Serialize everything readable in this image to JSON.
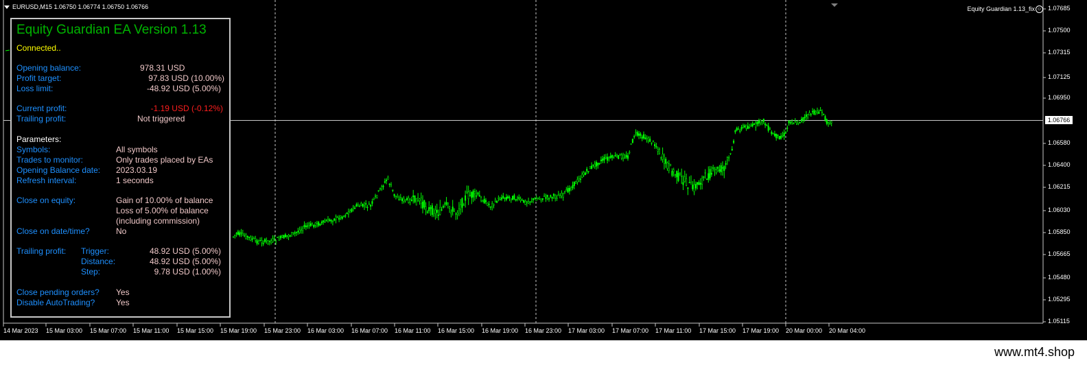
{
  "chart": {
    "header": "EURUSD,M15  1.06750 1.06774 1.06750 1.06766",
    "ea_label": "Equity Guardian 1.13_fix",
    "ea_smiley": "☺",
    "current_price": "1.06766",
    "price_ticks": [
      "1.07685",
      "1.07500",
      "1.07315",
      "1.07125",
      "1.06950",
      "1.06766",
      "1.06580",
      "1.06400",
      "1.06215",
      "1.06030",
      "1.05850",
      "1.05665",
      "1.05480",
      "1.05295",
      "1.05115"
    ],
    "time_ticks": [
      "14 Mar 2023",
      "15 Mar 03:00",
      "15 Mar 07:00",
      "15 Mar 11:00",
      "15 Mar 15:00",
      "15 Mar 19:00",
      "15 Mar 23:00",
      "16 Mar 03:00",
      "16 Mar 07:00",
      "16 Mar 11:00",
      "16 Mar 15:00",
      "16 Mar 19:00",
      "16 Mar 23:00",
      "17 Mar 03:00",
      "17 Mar 07:00",
      "17 Mar 11:00",
      "17 Mar 15:00",
      "17 Mar 19:00",
      "20 Mar 00:00",
      "20 Mar 04:00"
    ],
    "candle_color": "#00ff00",
    "grid_color": "#c8c8c8"
  },
  "panel": {
    "title": "Equity Guardian EA Version 1.13",
    "status": "Connected..",
    "opening_balance_label": "Opening balance:",
    "opening_balance_value": "978.31 USD",
    "profit_target_label": "Profit target:",
    "profit_target_value": "97.83 USD (10.00%)",
    "loss_limit_label": "Loss limit:",
    "loss_limit_value": "-48.92 USD (5.00%)",
    "current_profit_label": "Current profit:",
    "current_profit_value": "-1.19 USD (-0.12%)",
    "trailing_profit_label": "Trailing profit:",
    "trailing_profit_value": "Not triggered",
    "parameters_label": "Parameters:",
    "symbols_label": "Symbols:",
    "symbols_value": "All symbols",
    "trades_label": "Trades to monitor:",
    "trades_value": "Only trades placed by EAs",
    "ob_date_label": "Opening Balance date:",
    "ob_date_value": "2023.03.19",
    "refresh_label": "Refresh interval:",
    "refresh_value": "1 seconds",
    "close_equity_label": "Close on equity:",
    "close_equity_line1": "Gain of 10.00% of balance",
    "close_equity_line2": "Loss of 5.00% of balance",
    "close_equity_line3": "(including commission)",
    "close_date_label": "Close on date/time?",
    "close_date_value": "No",
    "trailing_label": "Trailing profit:",
    "trigger_label": "Trigger:",
    "trigger_value": "48.92 USD (5.00%)",
    "distance_label": "Distance:",
    "distance_value": "48.92 USD (5.00%)",
    "step_label": "Step:",
    "step_value": "9.78 USD (1.00%)",
    "close_pending_label": "Close pending orders?",
    "close_pending_value": "Yes",
    "disable_at_label": "Disable AutoTrading?",
    "disable_at_value": "Yes"
  },
  "footer": {
    "watermark": "www.mt4.shop"
  }
}
